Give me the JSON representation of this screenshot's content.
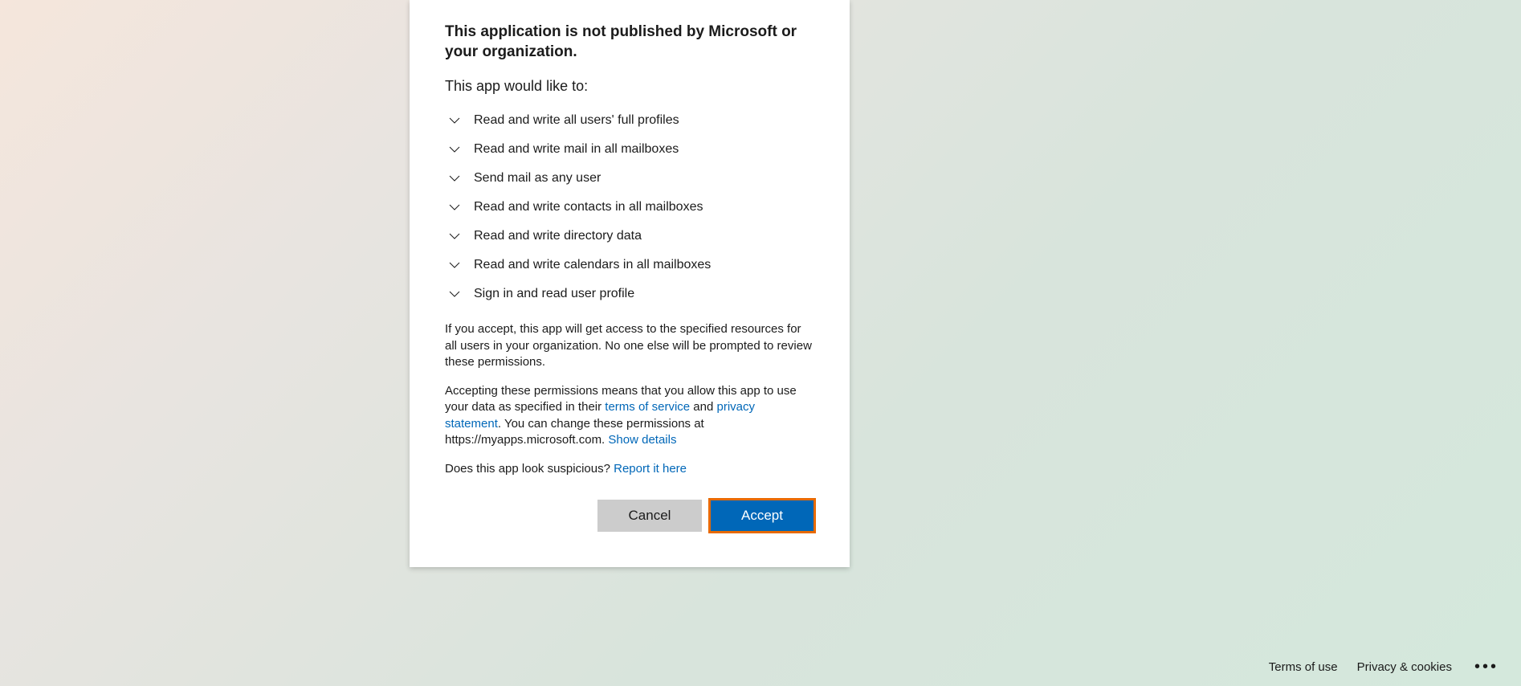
{
  "dialog": {
    "header": "This application is not published by Microsoft or your organization.",
    "intro": "This app would like to:",
    "permissions": [
      "Read and write all users' full profiles",
      "Read and write mail in all mailboxes",
      "Send mail as any user",
      "Read and write contacts in all mailboxes",
      "Read and write directory data",
      "Read and write calendars in all mailboxes",
      "Sign in and read user profile"
    ],
    "info1": "If you accept, this app will get access to the specified resources for all users in your organization. No one else will be prompted to review these permissions.",
    "info2_pre": "Accepting these permissions means that you allow this app to use your data as specified in their ",
    "terms_link": "terms of service",
    "info2_mid": " and ",
    "privacy_link": "privacy statement",
    "info2_post": ". You can change these permissions at https://myapps.microsoft.com. ",
    "show_details": "Show details",
    "suspicious_pre": "Does this app look suspicious? ",
    "report_link": "Report it here",
    "buttons": {
      "cancel": "Cancel",
      "accept": "Accept"
    }
  },
  "footer": {
    "terms": "Terms of use",
    "privacy": "Privacy & cookies"
  }
}
